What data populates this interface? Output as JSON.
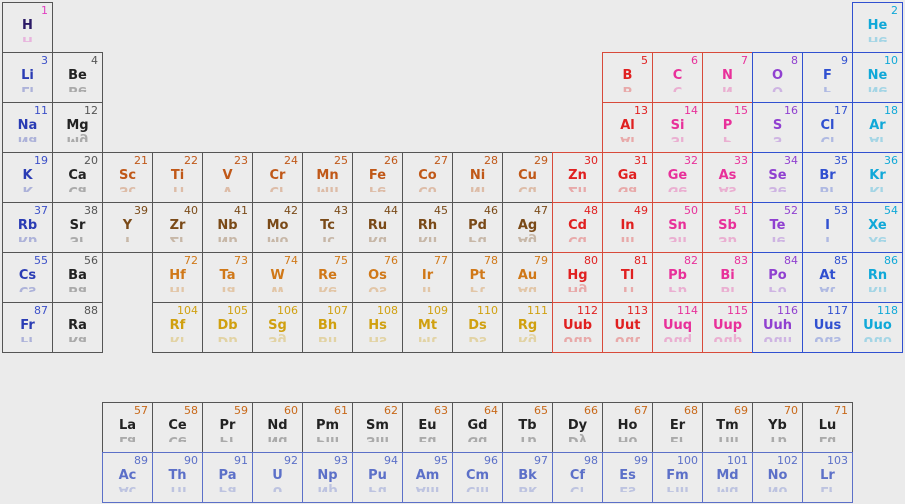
{
  "elements": [
    {
      "n": "1",
      "s": "H"
    },
    {
      "n": "2",
      "s": "He"
    },
    {
      "n": "3",
      "s": "Li"
    },
    {
      "n": "4",
      "s": "Be"
    },
    {
      "n": "5",
      "s": "B"
    },
    {
      "n": "6",
      "s": "C"
    },
    {
      "n": "7",
      "s": "N"
    },
    {
      "n": "8",
      "s": "O"
    },
    {
      "n": "9",
      "s": "F"
    },
    {
      "n": "10",
      "s": "Ne"
    },
    {
      "n": "11",
      "s": "Na"
    },
    {
      "n": "12",
      "s": "Mg"
    },
    {
      "n": "13",
      "s": "Al"
    },
    {
      "n": "14",
      "s": "Si"
    },
    {
      "n": "15",
      "s": "P"
    },
    {
      "n": "16",
      "s": "S"
    },
    {
      "n": "17",
      "s": "Cl"
    },
    {
      "n": "18",
      "s": "Ar"
    },
    {
      "n": "19",
      "s": "K"
    },
    {
      "n": "20",
      "s": "Ca"
    },
    {
      "n": "21",
      "s": "Sc"
    },
    {
      "n": "22",
      "s": "Ti"
    },
    {
      "n": "23",
      "s": "V"
    },
    {
      "n": "24",
      "s": "Cr"
    },
    {
      "n": "25",
      "s": "Mn"
    },
    {
      "n": "26",
      "s": "Fe"
    },
    {
      "n": "27",
      "s": "Co"
    },
    {
      "n": "28",
      "s": "Ni"
    },
    {
      "n": "29",
      "s": "Cu"
    },
    {
      "n": "30",
      "s": "Zn"
    },
    {
      "n": "31",
      "s": "Ga"
    },
    {
      "n": "32",
      "s": "Ge"
    },
    {
      "n": "33",
      "s": "As"
    },
    {
      "n": "34",
      "s": "Se"
    },
    {
      "n": "35",
      "s": "Br"
    },
    {
      "n": "36",
      "s": "Kr"
    },
    {
      "n": "37",
      "s": "Rb"
    },
    {
      "n": "38",
      "s": "Sr"
    },
    {
      "n": "39",
      "s": "Y"
    },
    {
      "n": "40",
      "s": "Zr"
    },
    {
      "n": "41",
      "s": "Nb"
    },
    {
      "n": "42",
      "s": "Mo"
    },
    {
      "n": "43",
      "s": "Tc"
    },
    {
      "n": "44",
      "s": "Ru"
    },
    {
      "n": "45",
      "s": "Rh"
    },
    {
      "n": "46",
      "s": "Pd"
    },
    {
      "n": "47",
      "s": "Ag"
    },
    {
      "n": "48",
      "s": "Cd"
    },
    {
      "n": "49",
      "s": "In"
    },
    {
      "n": "50",
      "s": "Sn"
    },
    {
      "n": "51",
      "s": "Sb"
    },
    {
      "n": "52",
      "s": "Te"
    },
    {
      "n": "53",
      "s": "I"
    },
    {
      "n": "54",
      "s": "Xe"
    },
    {
      "n": "55",
      "s": "Cs"
    },
    {
      "n": "56",
      "s": "Ba"
    },
    {
      "n": "72",
      "s": "Hf"
    },
    {
      "n": "73",
      "s": "Ta"
    },
    {
      "n": "74",
      "s": "W"
    },
    {
      "n": "75",
      "s": "Re"
    },
    {
      "n": "76",
      "s": "Os"
    },
    {
      "n": "77",
      "s": "Ir"
    },
    {
      "n": "78",
      "s": "Pt"
    },
    {
      "n": "79",
      "s": "Au"
    },
    {
      "n": "80",
      "s": "Hg"
    },
    {
      "n": "81",
      "s": "Tl"
    },
    {
      "n": "82",
      "s": "Pb"
    },
    {
      "n": "83",
      "s": "Bi"
    },
    {
      "n": "84",
      "s": "Po"
    },
    {
      "n": "85",
      "s": "At"
    },
    {
      "n": "86",
      "s": "Rn"
    },
    {
      "n": "87",
      "s": "Fr"
    },
    {
      "n": "88",
      "s": "Ra"
    },
    {
      "n": "104",
      "s": "Rf"
    },
    {
      "n": "105",
      "s": "Db"
    },
    {
      "n": "106",
      "s": "Sg"
    },
    {
      "n": "107",
      "s": "Bh"
    },
    {
      "n": "108",
      "s": "Hs"
    },
    {
      "n": "109",
      "s": "Mt"
    },
    {
      "n": "110",
      "s": "Ds"
    },
    {
      "n": "111",
      "s": "Rg"
    },
    {
      "n": "112",
      "s": "Uub"
    },
    {
      "n": "113",
      "s": "Uut"
    },
    {
      "n": "114",
      "s": "Uuq"
    },
    {
      "n": "115",
      "s": "Uup"
    },
    {
      "n": "116",
      "s": "Uuh"
    },
    {
      "n": "117",
      "s": "Uus"
    },
    {
      "n": "118",
      "s": "Uuo"
    },
    {
      "n": "57",
      "s": "La"
    },
    {
      "n": "58",
      "s": "Ce"
    },
    {
      "n": "59",
      "s": "Pr"
    },
    {
      "n": "60",
      "s": "Nd"
    },
    {
      "n": "61",
      "s": "Pm"
    },
    {
      "n": "62",
      "s": "Sm"
    },
    {
      "n": "63",
      "s": "Eu"
    },
    {
      "n": "64",
      "s": "Gd"
    },
    {
      "n": "65",
      "s": "Tb"
    },
    {
      "n": "66",
      "s": "Dy"
    },
    {
      "n": "67",
      "s": "Ho"
    },
    {
      "n": "68",
      "s": "Er"
    },
    {
      "n": "69",
      "s": "Tm"
    },
    {
      "n": "70",
      "s": "Yb"
    },
    {
      "n": "71",
      "s": "Lu"
    },
    {
      "n": "89",
      "s": "Ac"
    },
    {
      "n": "90",
      "s": "Th"
    },
    {
      "n": "91",
      "s": "Pa"
    },
    {
      "n": "92",
      "s": "U"
    },
    {
      "n": "93",
      "s": "Np"
    },
    {
      "n": "94",
      "s": "Pu"
    },
    {
      "n": "95",
      "s": "Am"
    },
    {
      "n": "96",
      "s": "Cm"
    },
    {
      "n": "97",
      "s": "Bk"
    },
    {
      "n": "98",
      "s": "Cf"
    },
    {
      "n": "99",
      "s": "Es"
    },
    {
      "n": "100",
      "s": "Fm"
    },
    {
      "n": "101",
      "s": "Md"
    },
    {
      "n": "102",
      "s": "No"
    },
    {
      "n": "103",
      "s": "Lr"
    }
  ],
  "colors": {
    "page_background": "#ebebeb",
    "cell_background": "#ececec",
    "hydrogen_symbol": "#2b1a66",
    "hydrogen_reflection": "#e040c0",
    "alkali_number": "#3c50c8",
    "alkali_symbol": "#2a3cb4",
    "default_border": "#555555",
    "default_symbol": "#222222",
    "row4_transition": "#c05818",
    "row5_transition": "#7a4a18",
    "row6_transition": "#d07818",
    "row7_transition": "#d0a010",
    "post_transition_red": "#e02020",
    "border_red": "#d84a3a",
    "metalloid_pink": "#e8309a",
    "chalcogen_purple": "#9040d0",
    "halogen_blue": "#3050d0",
    "noble_cyan": "#10a8d8",
    "lanthanide": "#c86818",
    "actinide": "#5c70c8"
  }
}
